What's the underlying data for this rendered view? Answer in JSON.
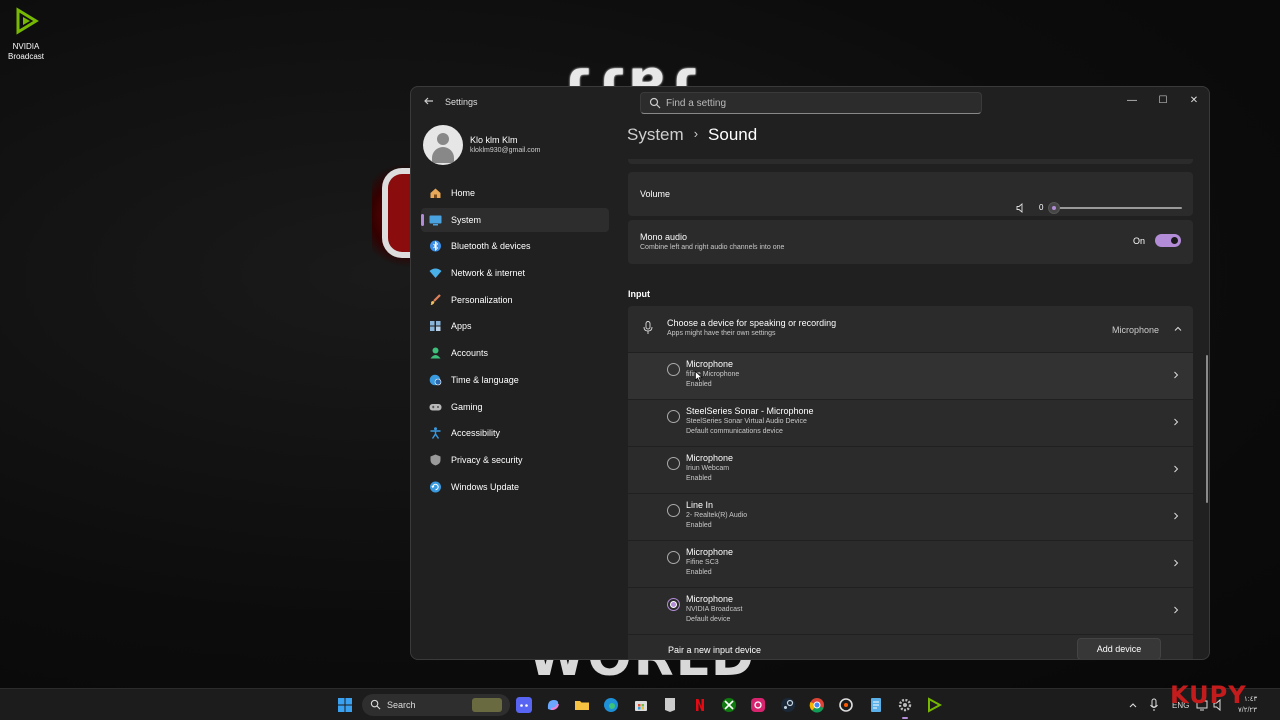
{
  "desktop": {
    "icon_label": "NVIDIA Broadcast",
    "wallpaper_top_text": "ɾɾɐɾ",
    "wallpaper_bottom_text": "WORLD"
  },
  "window": {
    "app_title": "Settings",
    "search_placeholder": "Find a setting",
    "controls": {
      "minimize": "—",
      "maximize": "☐",
      "close": "✕"
    }
  },
  "profile": {
    "name": "Klo klm Klm",
    "email": "kloklm930@gmail.com"
  },
  "nav": [
    {
      "label": "Home",
      "icon": "home-icon",
      "color": "#e8a85a"
    },
    {
      "label": "System",
      "icon": "system-icon",
      "color": "#4aa3df"
    },
    {
      "label": "Bluetooth & devices",
      "icon": "bluetooth-icon",
      "color": "#3a8ee6"
    },
    {
      "label": "Network & internet",
      "icon": "wifi-icon",
      "color": "#4ab0e8"
    },
    {
      "label": "Personalization",
      "icon": "brush-icon",
      "color": "#e0805a"
    },
    {
      "label": "Apps",
      "icon": "apps-icon",
      "color": "#8ab4d8"
    },
    {
      "label": "Accounts",
      "icon": "accounts-icon",
      "color": "#3cc07a"
    },
    {
      "label": "Time & language",
      "icon": "globe-clock-icon",
      "color": "#3a9ae0"
    },
    {
      "label": "Gaming",
      "icon": "gamepad-icon",
      "color": "#b8b8b8"
    },
    {
      "label": "Accessibility",
      "icon": "accessibility-icon",
      "color": "#3a9ae0"
    },
    {
      "label": "Privacy & security",
      "icon": "shield-icon",
      "color": "#9a9a9a"
    },
    {
      "label": "Windows Update",
      "icon": "update-icon",
      "color": "#3a9ae0"
    }
  ],
  "breadcrumb": {
    "parent": "System",
    "separator": "›",
    "current": "Sound"
  },
  "volume": {
    "label": "Volume",
    "value": "0",
    "level": 0
  },
  "mono": {
    "title": "Mono audio",
    "subtitle": "Combine left and right audio channels into one",
    "state": "On"
  },
  "input": {
    "section_label": "Input",
    "choose_title": "Choose a device for speaking or recording",
    "choose_subtitle": "Apps might have their own settings",
    "selected": "Microphone",
    "devices": [
      {
        "name": "Microphone",
        "desc": "fifine Microphone",
        "status": "Enabled",
        "checked": false
      },
      {
        "name": "SteelSeries Sonar - Microphone",
        "desc": "SteelSeries Sonar Virtual Audio Device",
        "status": "Default communications device",
        "checked": false
      },
      {
        "name": "Microphone",
        "desc": "Iriun Webcam",
        "status": "Enabled",
        "checked": false
      },
      {
        "name": "Line In",
        "desc": "2- Realtek(R) Audio",
        "status": "Enabled",
        "checked": false
      },
      {
        "name": "Microphone",
        "desc": "Fifine SC3",
        "status": "Enabled",
        "checked": false
      },
      {
        "name": "Microphone",
        "desc": "NVIDIA Broadcast",
        "status": "Default device",
        "checked": true
      }
    ],
    "pair_label": "Pair a new input device",
    "add_button": "Add device"
  },
  "taskbar": {
    "search_label": "Search",
    "language": "ENG",
    "time": "١:٤٣",
    "date": "٧/٢/٢٣",
    "watermark": "KUPY",
    "accent": "#b28cd6"
  }
}
